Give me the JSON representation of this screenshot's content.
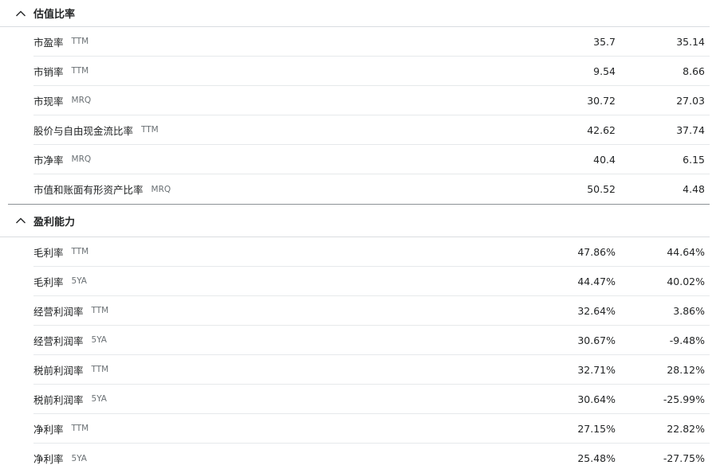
{
  "sections": [
    {
      "title": "估值比率",
      "chevron_icon": "chevron-up-icon",
      "rows": [
        {
          "label": "市盈率",
          "tag": "TTM",
          "value_a": "35.7",
          "value_b": "35.14"
        },
        {
          "label": "市销率",
          "tag": "TTM",
          "value_a": "9.54",
          "value_b": "8.66"
        },
        {
          "label": "市现率",
          "tag": "MRQ",
          "value_a": "30.72",
          "value_b": "27.03"
        },
        {
          "label": "股价与自由现金流比率",
          "tag": "TTM",
          "value_a": "42.62",
          "value_b": "37.74"
        },
        {
          "label": "市净率",
          "tag": "MRQ",
          "value_a": "40.4",
          "value_b": "6.15"
        },
        {
          "label": "市值和账面有形资产比率",
          "tag": "MRQ",
          "value_a": "50.52",
          "value_b": "4.48"
        }
      ]
    },
    {
      "title": "盈利能力",
      "chevron_icon": "chevron-up-icon",
      "rows": [
        {
          "label": "毛利率",
          "tag": "TTM",
          "value_a": "47.86%",
          "value_b": "44.64%"
        },
        {
          "label": "毛利率",
          "tag": "5YA",
          "value_a": "44.47%",
          "value_b": "40.02%"
        },
        {
          "label": "经营利润率",
          "tag": "TTM",
          "value_a": "32.64%",
          "value_b": "3.86%"
        },
        {
          "label": "经营利润率",
          "tag": "5YA",
          "value_a": "30.67%",
          "value_b": "-9.48%"
        },
        {
          "label": "税前利润率",
          "tag": "TTM",
          "value_a": "32.71%",
          "value_b": "28.12%"
        },
        {
          "label": "税前利润率",
          "tag": "5YA",
          "value_a": "30.64%",
          "value_b": "-25.99%"
        },
        {
          "label": "净利率",
          "tag": "TTM",
          "value_a": "27.15%",
          "value_b": "22.82%"
        },
        {
          "label": "净利率",
          "tag": "5YA",
          "value_a": "25.48%",
          "value_b": "-27.75%"
        }
      ]
    }
  ]
}
